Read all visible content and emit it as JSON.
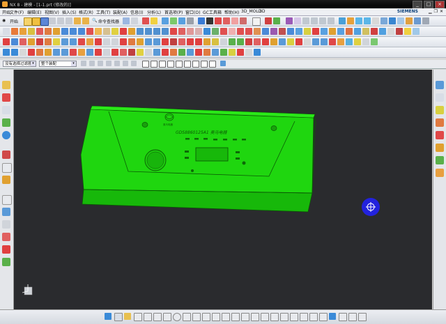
{
  "window": {
    "title": "NX 8 - 建模 - [1-1.prt (修改的)]",
    "min_label": "_",
    "max_label": "□",
    "close_label": "×"
  },
  "menu": {
    "start_label": "开始",
    "items": [
      "文件(F)",
      "编辑(E)",
      "视图(V)",
      "插入(S)",
      "格式(R)",
      "工具(T)",
      "装配(A)",
      "信息(I)",
      "分析(L)",
      "首选项(P)",
      "窗口(O)",
      "GC工具箱",
      "帮助(H)",
      "3D_MOLD",
      "3D"
    ],
    "brand": "SIEMENS"
  },
  "toolbar": {
    "command_finder_label": "命令查找器"
  },
  "selection_bar": {
    "filter_value": "没有选择过滤器",
    "scope_value": "整个装配"
  },
  "model": {
    "part_text": "GDS8860125A1 奥马电器",
    "brand_text": "奥马电器"
  },
  "colors": {
    "model_green": "#1fd60f",
    "viewport_bg": "#2a2b2e",
    "rotate_marker": "#2222dd"
  }
}
